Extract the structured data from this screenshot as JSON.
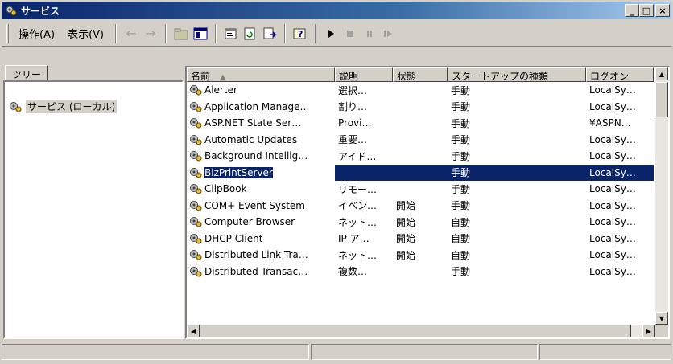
{
  "window": {
    "title": "サービス"
  },
  "title_buttons": {
    "minimize": "_",
    "maximize": "□",
    "close": "×"
  },
  "menu": [
    {
      "label": "操作(",
      "key": "A",
      "tail": ")"
    },
    {
      "label": "表示(",
      "key": "V",
      "tail": ")"
    }
  ],
  "toolbar_icons": [
    "back-arrow-icon",
    "forward-arrow-icon",
    "up-folder-icon",
    "show-hide-tree-icon",
    "properties-icon",
    "refresh-icon",
    "export-list-icon",
    "help-icon",
    "start-service-icon",
    "stop-service-icon",
    "pause-service-icon",
    "restart-service-icon"
  ],
  "tree": {
    "tab_label": "ツリー",
    "root_label": "サービス (ローカル)"
  },
  "list": {
    "columns": [
      "名前",
      "説明",
      "状態",
      "スタートアップの種類",
      "ログオン"
    ],
    "rows": [
      {
        "name": "Alerter",
        "desc": "選択…",
        "state": "",
        "startup": "手動",
        "logon": "LocalSy…"
      },
      {
        "name": "Application Manage…",
        "desc": "割り…",
        "state": "",
        "startup": "手動",
        "logon": "LocalSy…"
      },
      {
        "name": "ASP.NET State Ser…",
        "desc": "Provi…",
        "state": "",
        "startup": "手動",
        "logon": "¥ASPN…"
      },
      {
        "name": "Automatic Updates",
        "desc": "重要…",
        "state": "",
        "startup": "手動",
        "logon": "LocalSy…"
      },
      {
        "name": "Background Intellig…",
        "desc": "アイド…",
        "state": "",
        "startup": "手動",
        "logon": "LocalSy…"
      },
      {
        "name": "BizPrintServer",
        "desc": "",
        "state": "",
        "startup": "手動",
        "logon": "LocalSy…",
        "selected": true
      },
      {
        "name": "ClipBook",
        "desc": "リモー…",
        "state": "",
        "startup": "手動",
        "logon": "LocalSy…"
      },
      {
        "name": "COM+ Event System",
        "desc": "イベン…",
        "state": "開始",
        "startup": "手動",
        "logon": "LocalSy…"
      },
      {
        "name": "Computer Browser",
        "desc": "ネット…",
        "state": "開始",
        "startup": "自動",
        "logon": "LocalSy…"
      },
      {
        "name": "DHCP Client",
        "desc": "IP ア…",
        "state": "開始",
        "startup": "自動",
        "logon": "LocalSy…"
      },
      {
        "name": "Distributed Link Tra…",
        "desc": "ネット…",
        "state": "開始",
        "startup": "自動",
        "logon": "LocalSy…"
      },
      {
        "name": "Distributed Transac…",
        "desc": "複数…",
        "state": "",
        "startup": "手動",
        "logon": "LocalSy…"
      }
    ]
  },
  "colors": {
    "title_active": "#0a246a",
    "selection": "#0a246a",
    "face": "#d4d0c8"
  }
}
